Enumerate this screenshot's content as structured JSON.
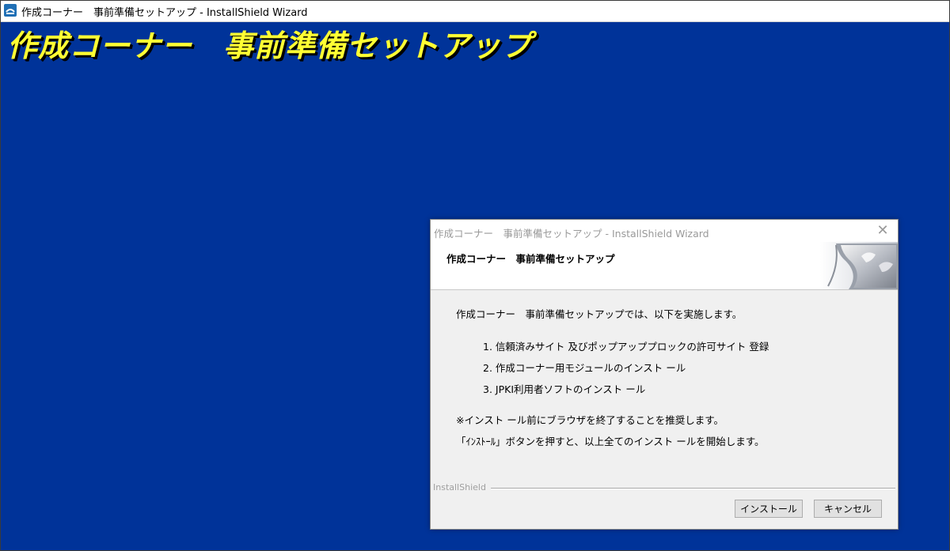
{
  "outer_window": {
    "title": "作成コーナー　事前準備セットアップ - InstallShield Wizard",
    "banner_title": "作成コーナー　事前準備セットアップ"
  },
  "dialog": {
    "title": "作成コーナー　事前準備セットアップ - InstallShield Wizard",
    "close_glyph": "✕",
    "header_title": "作成コーナー　事前準備セットアップ",
    "intro": "作成コーナー　事前準備セットアップでは、以下を実施します。",
    "steps": [
      "1. 信頼済みサイト 及びポップアッププロックの許可サイト 登録",
      "2. 作成コーナー用モジュールのインスト ール",
      "3. JPKI利用者ソフトのインスト ール"
    ],
    "note1": "※インスト ール前にブラウザを終了することを推奨します。",
    "note2": "「ｲﾝｽﾄｰﾙ」ボタンを押すと、以上全てのインスト ールを開始します。",
    "footer_brand": "InstallShield",
    "buttons": {
      "install": "インストール",
      "cancel": "キャンセル"
    }
  },
  "colors": {
    "background": "#003399",
    "banner_text": "#ffff33"
  },
  "icons": {
    "app": "installer-app-icon",
    "close": "close-icon",
    "header": "installshield-wizard-graphic"
  }
}
